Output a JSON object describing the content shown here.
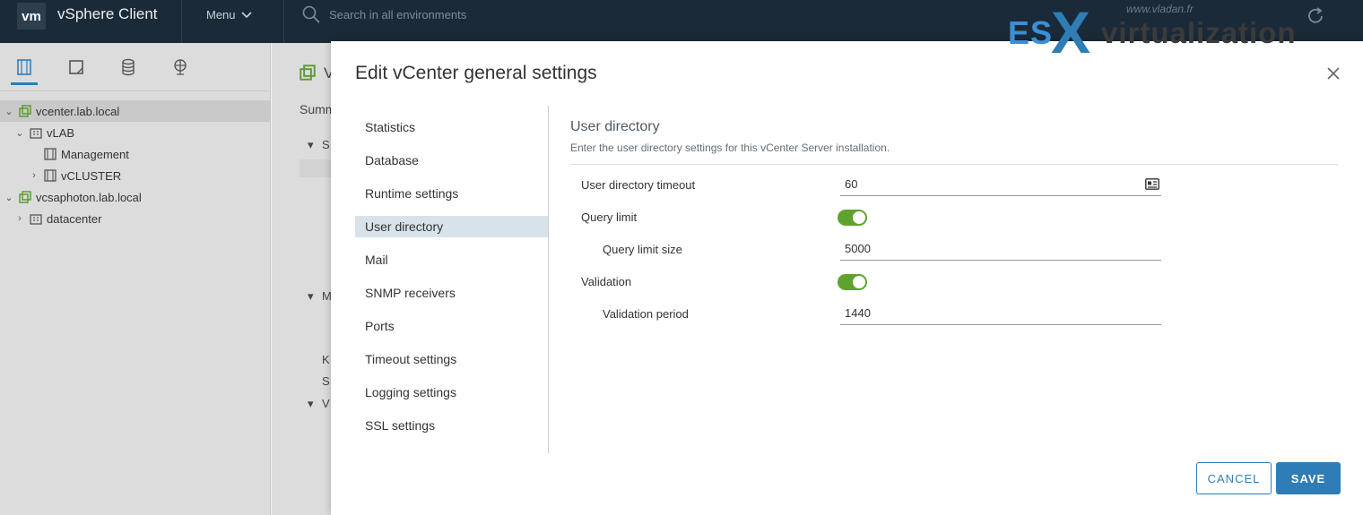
{
  "header": {
    "logo_text": "vm",
    "app_title": "vSphere Client",
    "menu_label": "Menu",
    "search_placeholder": "Search in all environments"
  },
  "navigator": {
    "tree": [
      {
        "label": "vcenter.lab.local",
        "type": "vcenter",
        "selected": true
      },
      {
        "label": "vLAB",
        "type": "datacenter"
      },
      {
        "label": "Management",
        "type": "cluster"
      },
      {
        "label": "vCLUSTER",
        "type": "cluster"
      },
      {
        "label": "vcsaphoton.lab.local",
        "type": "vcenter"
      },
      {
        "label": "datacenter",
        "type": "datacenter"
      }
    ]
  },
  "background_fragments": {
    "tab_summary": "Summ",
    "letter_v": "V",
    "frag_s": "S",
    "frag_m": "M",
    "frag_k": "K",
    "frag_s2": "S",
    "frag_v": "V"
  },
  "dialog": {
    "title": "Edit vCenter general settings",
    "menu": [
      {
        "label": "Statistics",
        "active": false
      },
      {
        "label": "Database",
        "active": false
      },
      {
        "label": "Runtime settings",
        "active": false
      },
      {
        "label": "User directory",
        "active": true
      },
      {
        "label": "Mail",
        "active": false
      },
      {
        "label": "SNMP receivers",
        "active": false
      },
      {
        "label": "Ports",
        "active": false
      },
      {
        "label": "Timeout settings",
        "active": false
      },
      {
        "label": "Logging settings",
        "active": false
      },
      {
        "label": "SSL settings",
        "active": false
      }
    ],
    "section": {
      "title": "User directory",
      "description": "Enter the user directory settings for this vCenter Server installation.",
      "fields": {
        "timeout_label": "User directory timeout",
        "timeout_value": "60",
        "query_limit_label": "Query limit",
        "query_limit_enabled": true,
        "query_limit_size_label": "Query limit size",
        "query_limit_size_value": "5000",
        "validation_label": "Validation",
        "validation_enabled": true,
        "validation_period_label": "Validation period",
        "validation_period_value": "1440"
      }
    },
    "buttons": {
      "cancel": "CANCEL",
      "save": "SAVE"
    }
  },
  "watermark": {
    "es": "ES",
    "x": "X",
    "virtualization": "virtualization",
    "url": "www.vladan.fr"
  },
  "colors": {
    "header_bg": "#1b2a38",
    "accent": "#2f7db6",
    "toggle_on": "#5fa32f",
    "active_menu_bg": "#d8e3e9"
  }
}
